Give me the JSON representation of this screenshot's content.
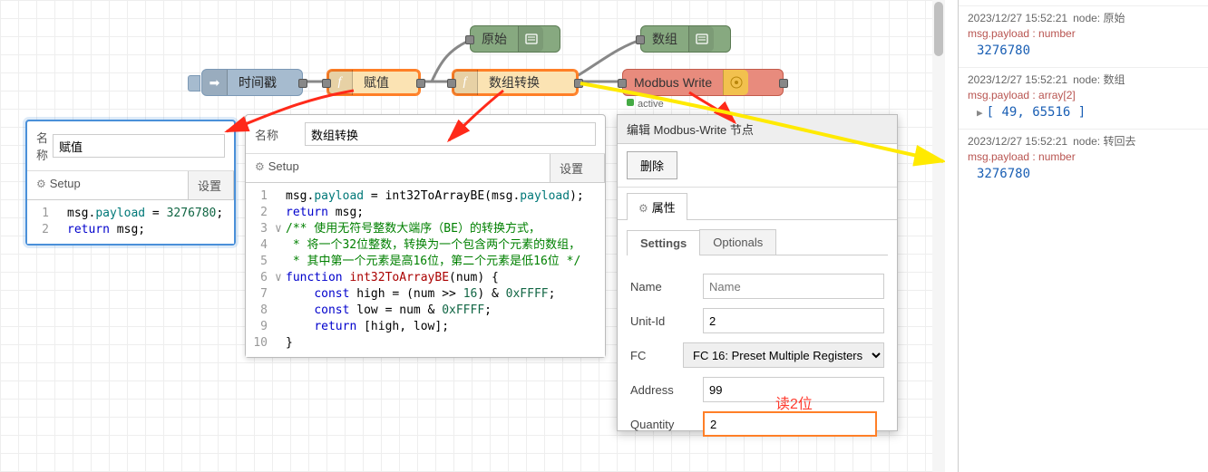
{
  "flow": {
    "inject": {
      "label": "时间戳"
    },
    "func1": {
      "label": "赋值"
    },
    "func2": {
      "label": "数组转换"
    },
    "debug1": {
      "label": "原始"
    },
    "debug2": {
      "label": "数组"
    },
    "modbus": {
      "label": "Modbus Write",
      "status": "active"
    }
  },
  "panel1": {
    "name_label": "名称",
    "name_value": "赋值",
    "tab_setup": "Setup",
    "tab_set": "设置",
    "code": {
      "l1": "msg.payload = 3276780;",
      "l2": "return msg;"
    }
  },
  "panel2": {
    "name_label": "名称",
    "name_value": "数组转换",
    "tab_setup": "Setup",
    "tab_set": "设置",
    "code": {
      "l1": "msg.payload = int32ToArrayBE(msg.payload);",
      "l2": "return msg;",
      "l3": "/** 使用无符号整数大端序（BE）的转换方式，",
      "l4": " * 将一个32位整数，转换为一个包含两个元素的数组，",
      "l5": " * 其中第一个元素是高16位，第二个元素是低16位 */",
      "l6": "function int32ToArrayBE(num) {",
      "l7": "    const high = (num >> 16) & 0xFFFF;",
      "l8": "    const low = num & 0xFFFF;",
      "l9": "    return [high, low];",
      "l10": "}"
    }
  },
  "dialog": {
    "title": "编辑 Modbus-Write 节点",
    "delete": "删除",
    "props": "属性",
    "tab_settings": "Settings",
    "tab_optionals": "Optionals",
    "fields": {
      "name_label": "Name",
      "name_placeholder": "Name",
      "unit_label": "Unit-Id",
      "unit_value": "2",
      "fc_label": "FC",
      "fc_value": "FC 16: Preset Multiple Registers",
      "addr_label": "Address",
      "addr_value": "99",
      "qty_label": "Quantity",
      "qty_value": "2",
      "qty_anno": "读2位"
    }
  },
  "debug": {
    "m1": {
      "ts": "2023/12/27 15:52:21",
      "node": "node: 原始",
      "type": "msg.payload : number",
      "val": "3276780"
    },
    "m2": {
      "ts": "2023/12/27 15:52:21",
      "node": "node: 数组",
      "type": "msg.payload : array[2]",
      "val": "[ 49, 65516 ]"
    },
    "m3": {
      "ts": "2023/12/27 15:52:21",
      "node": "node: 转回去",
      "type": "msg.payload : number",
      "val": "3276780"
    }
  }
}
